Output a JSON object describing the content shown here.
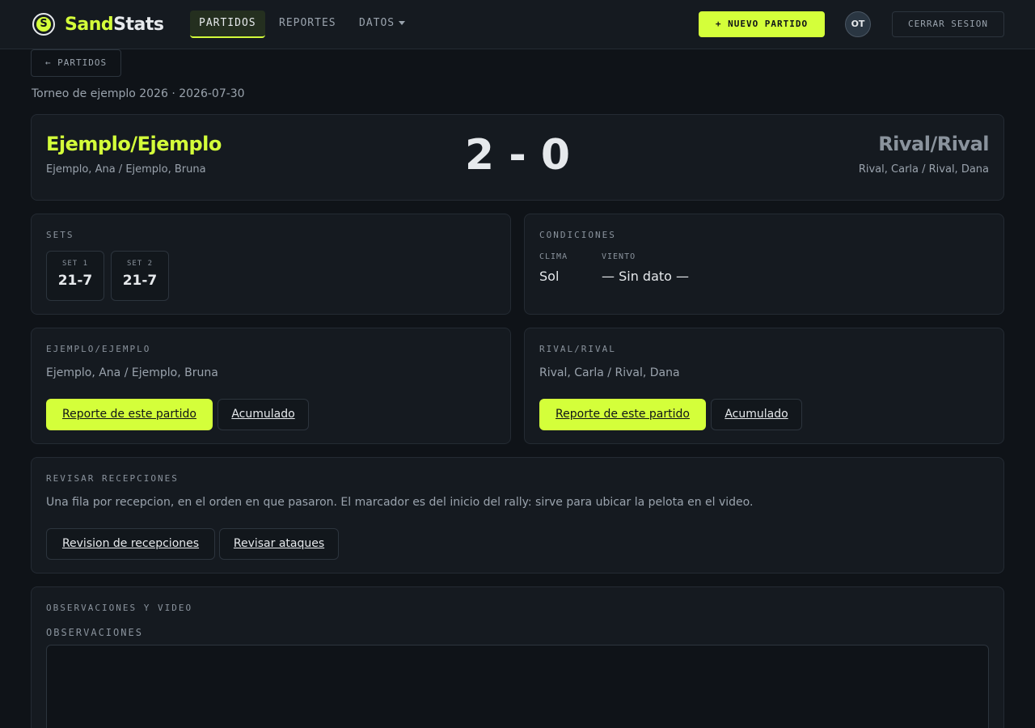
{
  "nav": {
    "brand_mark": "S",
    "brand_part1": "Sand",
    "brand_part2": "Stats",
    "items": [
      {
        "label": "PARTIDOS"
      },
      {
        "label": "REPORTES"
      },
      {
        "label": "DATOS"
      }
    ],
    "new_match_label": "+ NUEVO PARTIDO",
    "avatar_initials": "OT",
    "logout_label": "CERRAR SESION"
  },
  "back_label": "← PARTIDOS",
  "subtitle": "Torneo de ejemplo 2026 · 2026-07-30",
  "match": {
    "home_team": "Ejemplo/Ejemplo",
    "home_players": "Ejemplo, Ana / Ejemplo, Bruna",
    "score": "2 - 0",
    "away_team": "Rival/Rival",
    "away_players": "Rival, Carla / Rival, Dana"
  },
  "sets": {
    "title": "SETS",
    "items": [
      {
        "label": "SET 1",
        "score": "21-7"
      },
      {
        "label": "SET 2",
        "score": "21-7"
      }
    ]
  },
  "conditions": {
    "title": "CONDICIONES",
    "weather_label": "CLIMA",
    "weather_value": "Sol",
    "wind_label": "VIENTO",
    "wind_value": "— Sin dato —"
  },
  "home_card": {
    "title": "EJEMPLO/EJEMPLO",
    "players": "Ejemplo, Ana / Ejemplo, Bruna",
    "report_label": "Reporte de este partido",
    "cumulative_label": "Acumulado"
  },
  "away_card": {
    "title": "RIVAL/RIVAL",
    "players": "Rival, Carla / Rival, Dana",
    "report_label": "Reporte de este partido",
    "cumulative_label": "Acumulado"
  },
  "review": {
    "title": "REVISAR RECEPCIONES",
    "description": "Una fila por recepcion, en el orden en que pasaron. El marcador es del inicio del rally: sirve para ubicar la pelota en el video.",
    "reception_button": "Revision de recepciones",
    "attacks_button": "Revisar ataques"
  },
  "observations": {
    "title": "OBSERVACIONES Y VIDEO",
    "field_label": "OBSERVACIONES",
    "value": ""
  },
  "colors": {
    "accent": "#d4ff3a",
    "background": "#0f1318",
    "card": "#151a20"
  }
}
